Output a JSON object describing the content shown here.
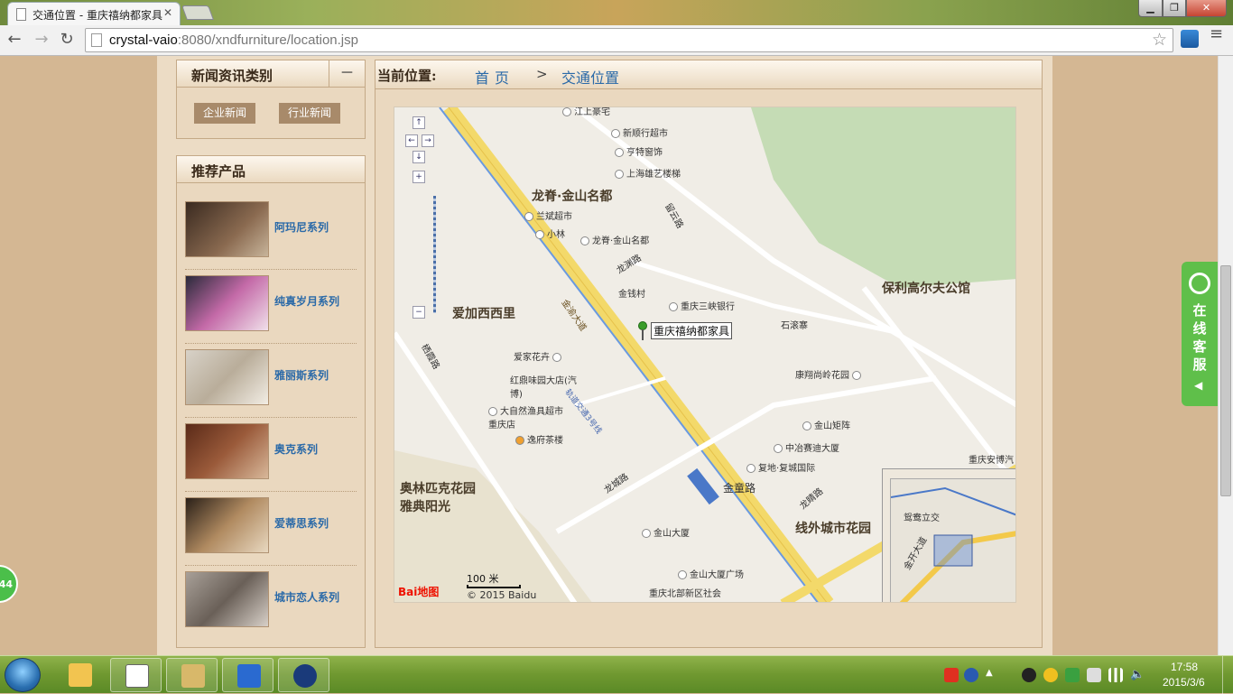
{
  "browser": {
    "tab_title": "交通位置 - 重庆禧纳都家具",
    "url_host": "crystal-vaio",
    "url_path": ":8080/xndfurniture/location.jsp"
  },
  "sidebar": {
    "news_title": "新闻资讯类别",
    "collapse_label": "－",
    "categories": [
      "企业新闻",
      "行业新闻"
    ],
    "products_title": "推荐产品",
    "products": [
      {
        "name": "阿玛尼系列"
      },
      {
        "name": "纯真岁月系列"
      },
      {
        "name": "雅丽斯系列"
      },
      {
        "name": "奥克系列"
      },
      {
        "name": "爱蒂思系列"
      },
      {
        "name": "城市恋人系列"
      }
    ]
  },
  "breadcrumb": {
    "label": "当前位置:",
    "home": "首页",
    "separator": ">",
    "current": "交通位置"
  },
  "map": {
    "marker_label": "重庆禧纳都家具",
    "scale_label": "100 米",
    "logo": "Bai地图",
    "copyright": "© 2015 Baidu",
    "areas": [
      "龙脊·金山名都",
      "保利高尔夫公馆",
      "爱加西西里",
      "奥林匹克花园雅典阳光",
      "线外城市花园"
    ],
    "pois": [
      "江上豪宅",
      "新顺行超市",
      "亨特窗饰",
      "上海雄艺楼梯",
      "兰斌超市",
      "小林",
      "龙脊·金山名都",
      "金钱村",
      "重庆三峡银行",
      "石滚寨",
      "爱家花卉",
      "红鼎味园大店(汽博)",
      "大自然渔具超市重庆店",
      "逸府茶楼",
      "康翔尚岭花园",
      "金山矩阵",
      "中冶赛迪大厦",
      "复地·复城国际",
      "金童路",
      "金山大厦",
      "金山大厦广场",
      "重庆北部新区社会保险局",
      "重庆安博汽"
    ],
    "roads": [
      "金渝大道",
      "龙渊路",
      "龙城路",
      "栖霞路",
      "留云路",
      "龙睛路",
      "轨道交通3号线"
    ],
    "minimap_labels": [
      "鸳鸯立交",
      "金开大道"
    ]
  },
  "side_service": {
    "text": "在线客服"
  },
  "left_badge": "44",
  "taskbar": {
    "time": "17:58",
    "date": "2015/3/6"
  }
}
